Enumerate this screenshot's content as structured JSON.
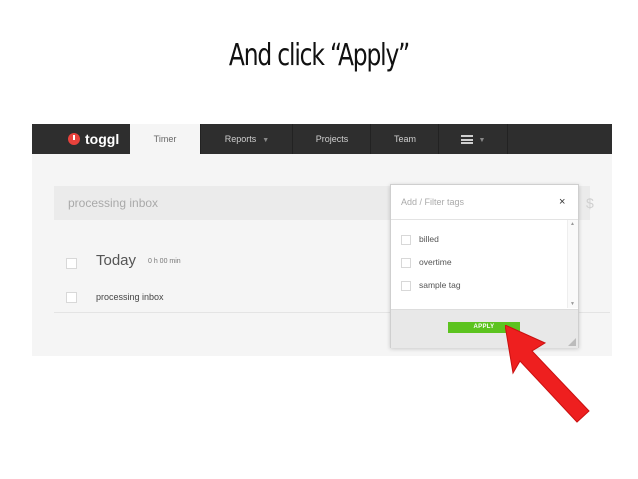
{
  "slide": {
    "title": "And click “Apply”"
  },
  "navbar": {
    "logo_text": "toggl",
    "tabs": [
      {
        "label": "Timer"
      },
      {
        "label": "Reports"
      },
      {
        "label": "Projects"
      },
      {
        "label": "Team"
      }
    ]
  },
  "timer": {
    "description": "processing inbox",
    "billable_symbol": "$"
  },
  "day_group": {
    "label": "Today",
    "total": "0 h 00 min"
  },
  "entries": [
    {
      "description": "processing inbox"
    }
  ],
  "tag_dropdown": {
    "placeholder": "Add / Filter tags",
    "close_symbol": "×",
    "tags": [
      {
        "name": "billed",
        "checked": false
      },
      {
        "name": "overtime",
        "checked": false
      },
      {
        "name": "sample tag",
        "checked": false
      }
    ],
    "apply_label": "APPLY"
  },
  "colors": {
    "navbar": "#2e2e2e",
    "logo_red": "#e8423c",
    "apply_green": "#5cc31f",
    "arrow_red": "#ee1f1f"
  }
}
